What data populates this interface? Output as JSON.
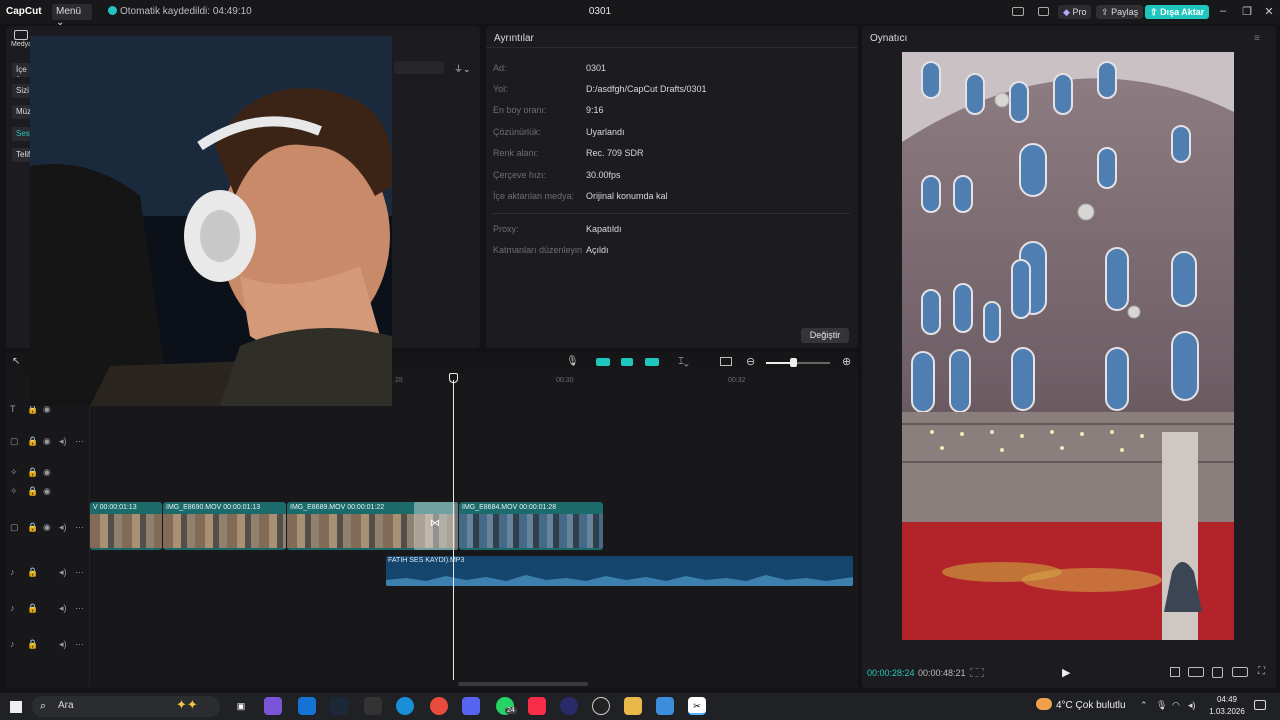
{
  "app": {
    "logo": "CapCut",
    "menu_label": "Menü",
    "autosave": "Otomatik kaydedildi: 04:49:10",
    "project_title": "0301",
    "pro_label": "Pro",
    "share_label": "Paylaş",
    "export_label": "Dışa Aktar",
    "accent_color": "#1fc6bd"
  },
  "media_panel": {
    "tab_label": "Medya",
    "side_items": [
      "İçe a",
      "Sizi",
      "Müz",
      "Ses",
      "Telif"
    ]
  },
  "details": {
    "header": "Ayrıntılar",
    "rows": [
      {
        "label": "Ad:",
        "value": "0301"
      },
      {
        "label": "Yol:",
        "value": "D:/asdfgh/CapCut Drafts/0301"
      },
      {
        "label": "En boy oranı:",
        "value": "9:16"
      },
      {
        "label": "Çözünürlük:",
        "value": "Uyarlandı"
      },
      {
        "label": "Renk alanı:",
        "value": "Rec. 709 SDR"
      },
      {
        "label": "Çerçeve hızı:",
        "value": "30.00fps"
      },
      {
        "label": "İçe aktarılan medya:",
        "value": "Orijinal konumda kal"
      }
    ],
    "rows2": [
      {
        "label": "Proxy:",
        "value": "Kapatıldı"
      },
      {
        "label": "Katmanları düzenleyin",
        "value": "Açıldı"
      }
    ],
    "change_button": "Değiştir"
  },
  "player": {
    "header": "Oynatıcı",
    "time_current": "00:00:28:24",
    "time_total": "00:00:48:21"
  },
  "timeline": {
    "ticks": [
      "28",
      "00:30",
      "00:32"
    ],
    "video_clips": [
      {
        "label": "V  00:00:01:13"
      },
      {
        "label": "IMG_E8690.MOV  00:00:01:13"
      },
      {
        "label": "IMG_E8689.MOV  00:00:01:22"
      },
      {
        "label": "IMG_E8684.MOV  00:00:01:28"
      }
    ],
    "audio_clip": "FATİH SES KAYDI).MP3"
  },
  "taskbar": {
    "search": "Ara",
    "weather": "4°C  Çok bulutlu",
    "time": "04:49",
    "date": "1.03.2026",
    "badge": "24"
  }
}
